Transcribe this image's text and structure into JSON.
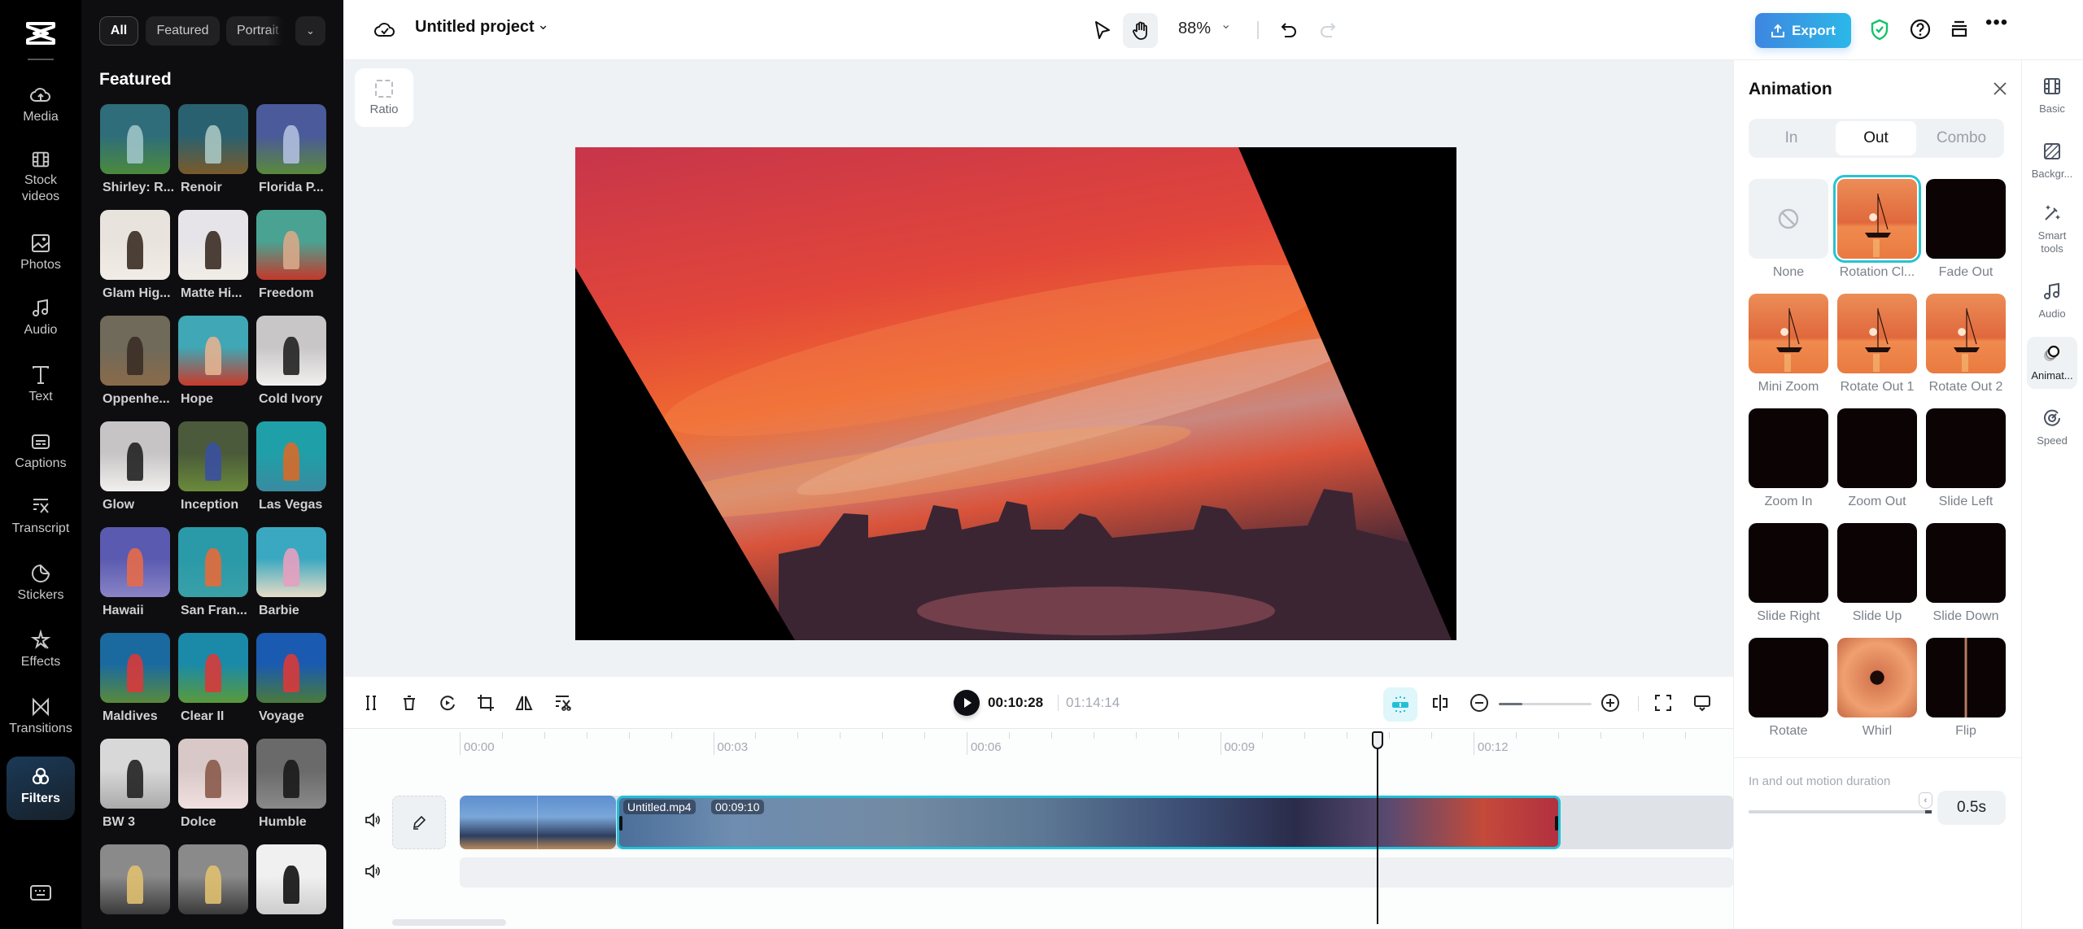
{
  "app": {
    "accent": "#25c4d4",
    "export_gradient": [
      "#3e86e0",
      "#2bb8e8"
    ]
  },
  "left_rail": {
    "items": [
      {
        "label": "Media",
        "icon": "cloud-upload-icon"
      },
      {
        "label": "Stock\nvideos",
        "icon": "film-icon"
      },
      {
        "label": "Photos",
        "icon": "image-icon"
      },
      {
        "label": "Audio",
        "icon": "music-icon"
      },
      {
        "label": "Text",
        "icon": "text-icon"
      },
      {
        "label": "Captions",
        "icon": "captions-icon"
      },
      {
        "label": "Transcript",
        "icon": "transcript-icon"
      },
      {
        "label": "Stickers",
        "icon": "sticker-icon"
      },
      {
        "label": "Effects",
        "icon": "sparkle-star-icon"
      },
      {
        "label": "Transitions",
        "icon": "bowtie-icon"
      },
      {
        "label": "Filters",
        "icon": "filters-circles-icon",
        "active": true
      }
    ],
    "keyboard_icon": "keyboard-icon"
  },
  "filters_panel": {
    "chips": [
      "All",
      "Featured",
      "Portrait"
    ],
    "active_chip": "All",
    "section_title": "Featured",
    "items": [
      {
        "label": "Shirley: R..."
      },
      {
        "label": "Renoir"
      },
      {
        "label": "Florida P..."
      },
      {
        "label": "Glam Hig..."
      },
      {
        "label": "Matte Hi..."
      },
      {
        "label": "Freedom"
      },
      {
        "label": "Oppenhe..."
      },
      {
        "label": "Hope"
      },
      {
        "label": "Cold Ivory"
      },
      {
        "label": "Glow"
      },
      {
        "label": "Inception"
      },
      {
        "label": "Las Vegas"
      },
      {
        "label": "Hawaii"
      },
      {
        "label": "San Fran..."
      },
      {
        "label": "Barbie"
      },
      {
        "label": "Maldives"
      },
      {
        "label": "Clear II"
      },
      {
        "label": "Voyage"
      },
      {
        "label": "BW 3"
      },
      {
        "label": "Dolce"
      },
      {
        "label": "Humble"
      },
      {
        "label": ""
      },
      {
        "label": ""
      },
      {
        "label": ""
      }
    ]
  },
  "header": {
    "project_title": "Untitled project",
    "zoom_level": "88%",
    "export_label": "Export"
  },
  "canvas": {
    "ratio_label": "Ratio"
  },
  "timeline": {
    "current_time": "00:10:28",
    "total_time": "01:14:14",
    "ruler_labels": [
      "00:00",
      "00:03",
      "00:06",
      "00:09",
      "00:12"
    ],
    "clip": {
      "name": "Untitled.mp4",
      "duration": "00:09:10"
    },
    "zoom_slider_fraction": 0.25
  },
  "animation_panel": {
    "title": "Animation",
    "tabs": [
      "In",
      "Out",
      "Combo"
    ],
    "active_tab": "Out",
    "presets": [
      {
        "label": "None",
        "kind": "none"
      },
      {
        "label": "Rotation Cl...",
        "kind": "sunset",
        "selected": true
      },
      {
        "label": "Fade Out",
        "kind": "dark"
      },
      {
        "label": "Mini Zoom",
        "kind": "sunset"
      },
      {
        "label": "Rotate Out 1",
        "kind": "sunset"
      },
      {
        "label": "Rotate Out 2",
        "kind": "sunset"
      },
      {
        "label": "Zoom In",
        "kind": "dark"
      },
      {
        "label": "Zoom Out",
        "kind": "dark"
      },
      {
        "label": "Slide Left",
        "kind": "dark"
      },
      {
        "label": "Slide Right",
        "kind": "dark"
      },
      {
        "label": "Slide Up",
        "kind": "dark"
      },
      {
        "label": "Slide Down",
        "kind": "dark"
      },
      {
        "label": "Rotate",
        "kind": "dark"
      },
      {
        "label": "Whirl",
        "kind": "whirl"
      },
      {
        "label": "Flip",
        "kind": "flip"
      }
    ],
    "duration_label": "In and out motion duration",
    "duration_value": "0.5s",
    "duration_slider_fraction": 1.0
  },
  "right_rail": {
    "items": [
      {
        "label": "Basic"
      },
      {
        "label": "Backgr..."
      },
      {
        "label": "Smart\ntools"
      },
      {
        "label": "Audio"
      },
      {
        "label": "Animat...",
        "active": true
      },
      {
        "label": "Speed"
      }
    ]
  }
}
